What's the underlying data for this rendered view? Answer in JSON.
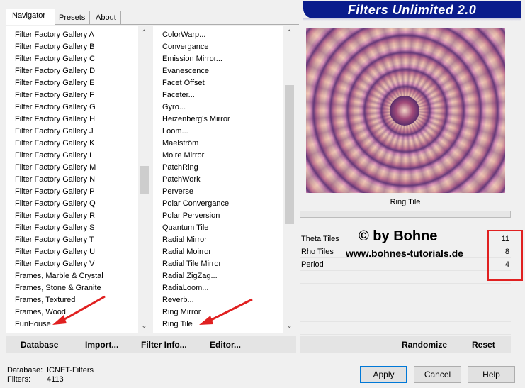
{
  "tabs": [
    {
      "label": "Navigator",
      "active": true
    },
    {
      "label": "Presets",
      "active": false
    },
    {
      "label": "About",
      "active": false
    }
  ],
  "logo": "Filters Unlimited 2.0",
  "categories": [
    "Filter Factory Gallery A",
    "Filter Factory Gallery B",
    "Filter Factory Gallery C",
    "Filter Factory Gallery D",
    "Filter Factory Gallery E",
    "Filter Factory Gallery F",
    "Filter Factory Gallery G",
    "Filter Factory Gallery H",
    "Filter Factory Gallery J",
    "Filter Factory Gallery K",
    "Filter Factory Gallery L",
    "Filter Factory Gallery M",
    "Filter Factory Gallery N",
    "Filter Factory Gallery P",
    "Filter Factory Gallery Q",
    "Filter Factory Gallery R",
    "Filter Factory Gallery S",
    "Filter Factory Gallery T",
    "Filter Factory Gallery U",
    "Filter Factory Gallery V",
    "Frames, Marble & Crystal",
    "Frames, Stone & Granite",
    "Frames, Textured",
    "Frames, Wood",
    "FunHouse"
  ],
  "filters": [
    "ColorWarp...",
    "Convergance",
    "Emission Mirror...",
    "Evanescence",
    "Facet Offset",
    "Faceter...",
    "Gyro...",
    "Heizenberg's Mirror",
    "Loom...",
    "Maelström",
    "Moire Mirror",
    "PatchRing",
    "PatchWork",
    "Perverse",
    "Polar Convergance",
    "Polar Perversion",
    "Quantum Tile",
    "Radial Mirror",
    "Radial Moirror",
    "Radial Tile Mirror",
    "Radial ZigZag...",
    "RadiaLoom...",
    "Reverb...",
    "Ring Mirror",
    "Ring Tile"
  ],
  "selected_filter": "Ring Tile",
  "params": [
    {
      "name": "Theta Tiles",
      "value": "11"
    },
    {
      "name": "Rho Tiles",
      "value": "8"
    },
    {
      "name": "Period",
      "value": "4"
    }
  ],
  "watermark": {
    "line1": "© by Bohne",
    "line2": "www.bohnes-tutorials.de"
  },
  "left_buttons": {
    "database": "Database",
    "import": "Import...",
    "filter_info": "Filter Info...",
    "editor": "Editor..."
  },
  "right_buttons": {
    "randomize": "Randomize",
    "reset": "Reset"
  },
  "status": {
    "database_label": "Database:",
    "database_value": "ICNET-Filters",
    "filters_label": "Filters:",
    "filters_value": "4113"
  },
  "dialog_buttons": {
    "apply": "Apply",
    "cancel": "Cancel",
    "help": "Help"
  },
  "colors": {
    "logo_bg": "#0a1c8c",
    "annotation_red": "#e02020",
    "focus_blue": "#0078d7"
  }
}
